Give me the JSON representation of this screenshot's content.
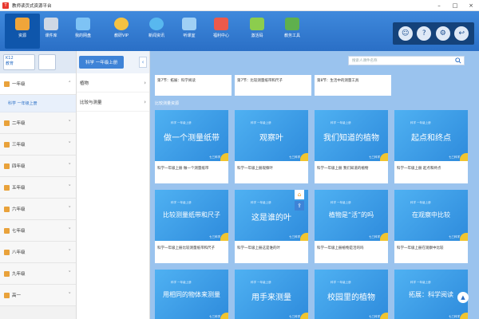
{
  "window": {
    "title": "教师读页式资源平台",
    "logo_text": "T"
  },
  "toolbar": {
    "items": [
      {
        "label": "资源",
        "icon": "resource-icon",
        "color": "#f0a53a"
      },
      {
        "label": "课件库",
        "icon": "courseware-icon",
        "color": "#cfd8e5"
      },
      {
        "label": "我的网盘",
        "icon": "cloud-drive-icon",
        "color": "#7ec3f5"
      },
      {
        "label": "教研VIP",
        "icon": "vip-icon",
        "color": "#f5c242"
      },
      {
        "label": "新闻资讯",
        "icon": "news-icon",
        "color": "#58b8ef"
      },
      {
        "label": "听课室",
        "icon": "classroom-icon",
        "color": "#9fd0f5"
      },
      {
        "label": "福利中心",
        "icon": "gift-icon",
        "color": "#ec5a4b"
      },
      {
        "label": "激活码",
        "icon": "activation-icon",
        "color": "#8ccd4d"
      },
      {
        "label": "教务工具",
        "icon": "tools-icon",
        "color": "#5fb04d"
      }
    ],
    "right_icons": [
      "user-icon",
      "help-icon",
      "settings-icon",
      "logout-icon"
    ]
  },
  "sidebar": {
    "k12_label": "K12",
    "k12_sub": "教育",
    "grades": [
      {
        "label": "一年级",
        "expanded": true,
        "sub": "科学 一年级上册"
      },
      {
        "label": "二年级"
      },
      {
        "label": "三年级"
      },
      {
        "label": "四年级"
      },
      {
        "label": "五年级"
      },
      {
        "label": "六年级"
      },
      {
        "label": "七年级"
      },
      {
        "label": "八年级"
      },
      {
        "label": "九年级"
      },
      {
        "label": "高一"
      }
    ]
  },
  "midpanel": {
    "title": "科学 一年级上册",
    "items": [
      "植物",
      "比较与测量"
    ]
  },
  "content": {
    "search_placeholder": "搜索人课件名称",
    "top_row": [
      "第7节：拓展：科学阅读",
      "第7节：比较测量纸带和尺子",
      "第8节：生活中的测量工具"
    ],
    "section_label": "比较测量资源",
    "cards": [
      {
        "tag": "科学 一年级上册",
        "title": "做一个测量纸带",
        "caption": "科学一年级上册 做一个测量纸带",
        "brand": "七三科学"
      },
      {
        "tag": "科学 一年级上册",
        "title": "观察叶",
        "caption": "科学一年级上册观察叶",
        "brand": "七三科学"
      },
      {
        "tag": "科学 一年级上册",
        "title": "我们知道的植物",
        "caption": "科学一年级上册 我们知道的植物",
        "brand": "七三科学"
      },
      {
        "tag": "科学 一年级上册",
        "title": "起点和终点",
        "caption": "科学一年级上册 起点和终点",
        "brand": "七三科学"
      },
      {
        "tag": "科学 一年级上册",
        "title": "比较测量纸带和尺子",
        "caption": "科学一年级上册比较测量纸带和尺子",
        "brand": "七三科学"
      },
      {
        "tag": "科学 一年级上册",
        "title": "这是谁的叶",
        "caption": "科学一年级上册这是谁的叶",
        "brand": "七三科学"
      },
      {
        "tag": "科学 一年级上册",
        "title": "植物是“活”的吗",
        "caption": "科学一年级上册植物是活的吗",
        "brand": "七三科学"
      },
      {
        "tag": "科学 一年级上册",
        "title": "在观察中比较",
        "caption": "科学一年级上册在观察中比较",
        "brand": "七三科学"
      },
      {
        "tag": "科学 一年级上册",
        "title": "用相同的物体来测量",
        "caption": "",
        "brand": "七三科学"
      },
      {
        "tag": "科学 一年级上册",
        "title": "用手来测量",
        "caption": "",
        "brand": "七三科学"
      },
      {
        "tag": "科学 一年级上册",
        "title": "校园里的植物",
        "caption": "",
        "brand": "七三科学"
      },
      {
        "tag": "科学 一年级上册",
        "title": "拓展：科学阅读",
        "caption": "",
        "brand": "七三科学"
      }
    ]
  }
}
